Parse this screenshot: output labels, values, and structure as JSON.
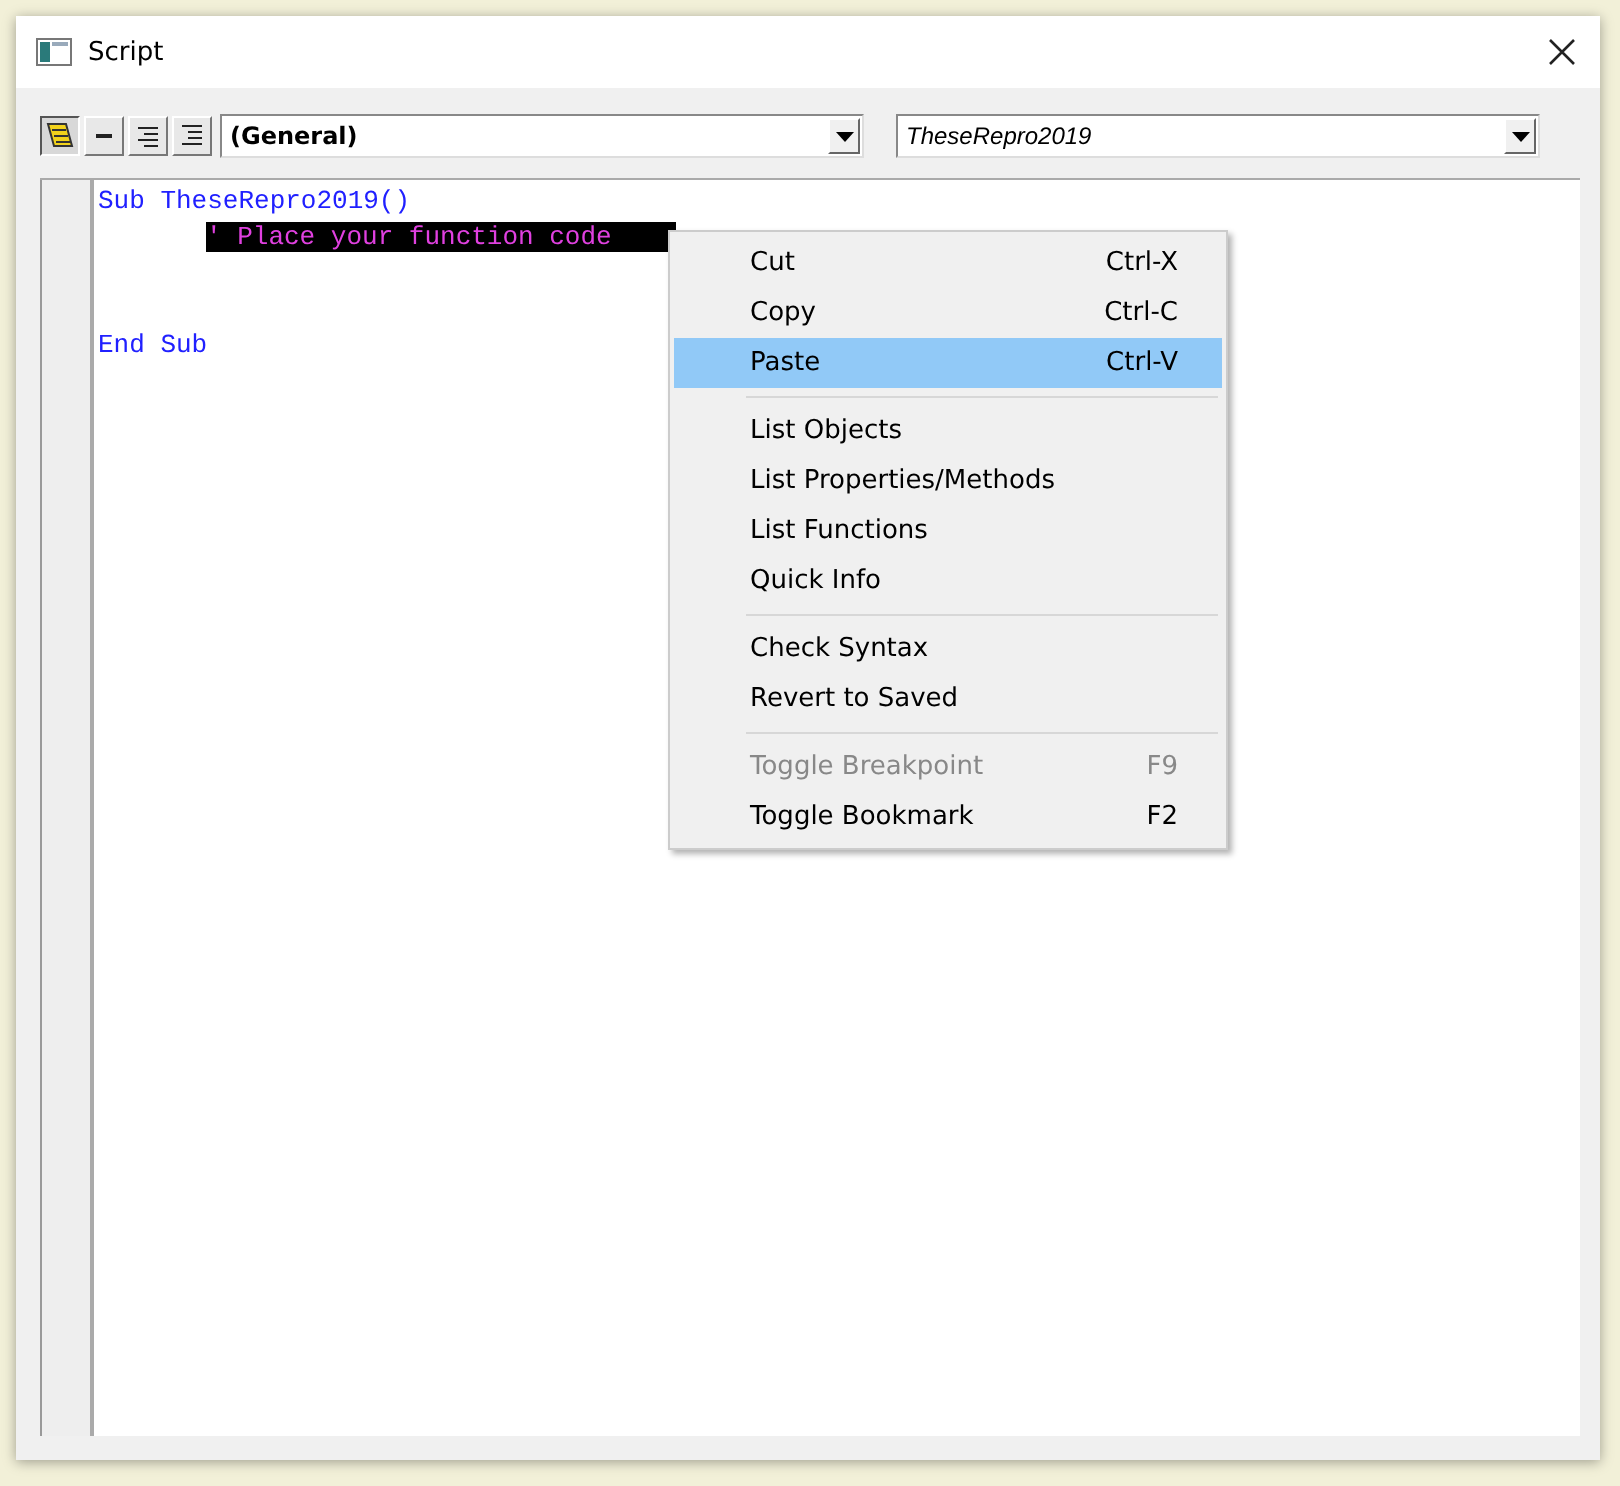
{
  "window": {
    "title": "Script"
  },
  "toolbar": {
    "buttons": [
      {
        "kind": "scroll",
        "selected": true
      },
      {
        "kind": "align-top",
        "selected": false
      },
      {
        "kind": "align-right",
        "selected": false
      },
      {
        "kind": "align-indent",
        "selected": false
      }
    ],
    "object_dropdown": {
      "value": "(General)"
    },
    "procedure_dropdown": {
      "value": "TheseRepro2019"
    }
  },
  "editor": {
    "lines": [
      {
        "kind": "code",
        "text": "Sub TheseRepro2019()",
        "highlighted": false,
        "children": [
          {
            "kind": "comment",
            "text": "' Place your function code",
            "highlighted": true
          },
          {
            "kind": "blank"
          },
          {
            "kind": "blank"
          }
        ]
      },
      {
        "kind": "code",
        "text": "End Sub",
        "highlighted": false
      }
    ]
  },
  "context_menu": {
    "groups": [
      {
        "items": [
          {
            "label": "Cut",
            "shortcut": "Ctrl-X",
            "selected": false,
            "disabled": false
          },
          {
            "label": "Copy",
            "shortcut": "Ctrl-C",
            "selected": false,
            "disabled": false
          },
          {
            "label": "Paste",
            "shortcut": "Ctrl-V",
            "selected": true,
            "disabled": false
          }
        ]
      },
      {
        "items": [
          {
            "label": "List Objects",
            "selected": false,
            "disabled": false
          },
          {
            "label": "List Properties/Methods",
            "selected": false,
            "disabled": false
          },
          {
            "label": "List Functions",
            "selected": false,
            "disabled": false
          },
          {
            "label": "Quick Info",
            "selected": false,
            "disabled": false
          }
        ]
      },
      {
        "items": [
          {
            "label": "Check Syntax",
            "selected": false,
            "disabled": false
          },
          {
            "label": "Revert to Saved",
            "selected": false,
            "disabled": false
          }
        ]
      },
      {
        "items": [
          {
            "label": "Toggle Breakpoint",
            "shortcut": "F9",
            "selected": false,
            "disabled": true
          },
          {
            "label": "Toggle Bookmark",
            "shortcut": "F2",
            "selected": false,
            "disabled": false
          }
        ]
      }
    ]
  }
}
